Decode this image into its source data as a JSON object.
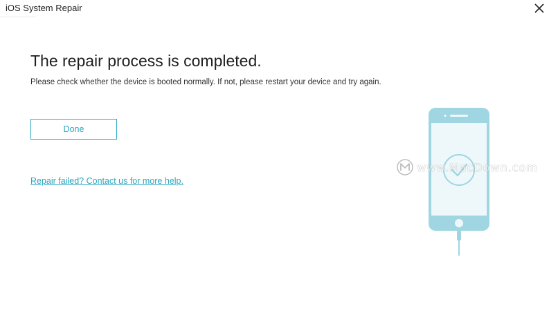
{
  "window": {
    "title": "iOS System Repair"
  },
  "main": {
    "heading": "The repair process is completed.",
    "subtext": "Please check whether the device is booted normally. If not, please restart your device and try again.",
    "done_button_label": "Done",
    "help_link_text": "Repair failed? Contact us for more help."
  },
  "watermark": {
    "text": "www.MacDown.com"
  },
  "icons": {
    "close": "close-icon",
    "phone": "phone-illustration",
    "check": "checkmark-icon",
    "watermark_logo": "macdown-logo-icon"
  },
  "colors": {
    "accent": "#2aa6c2",
    "phone_body": "#9fd6e2",
    "phone_screen": "#eef8fa"
  }
}
